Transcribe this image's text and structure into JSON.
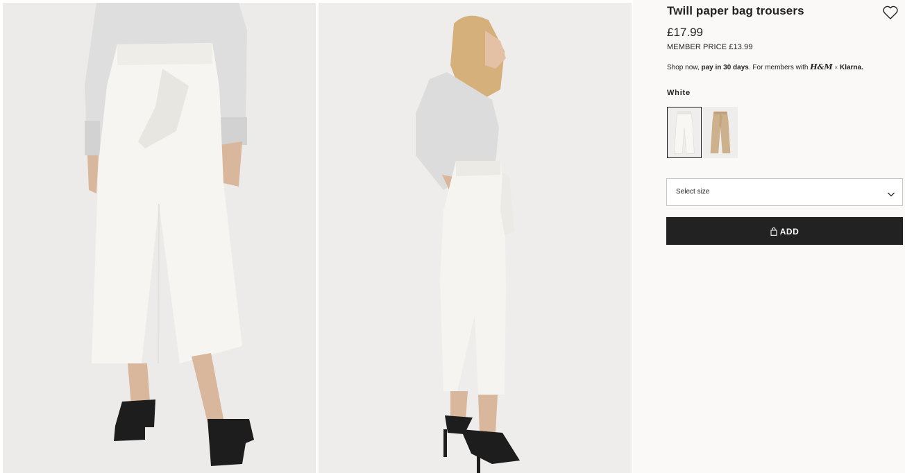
{
  "product": {
    "title": "Twill paper bag trousers",
    "price": "£17.99",
    "member_price": "MEMBER PRICE £13.99",
    "klarna": {
      "prefix": "Shop now, ",
      "bold": "pay in 30 days",
      "suffix": ". For members with ",
      "hm_logo": "H&M",
      "separator": "×",
      "klarna_brand": "Klarna."
    },
    "favorite_icon": "heart-icon"
  },
  "images": [
    {
      "alt": "trousers-front-view"
    },
    {
      "alt": "trousers-side-view"
    }
  ],
  "color": {
    "selected_label": "White",
    "swatches": [
      {
        "name": "white",
        "hex": "#f1efe8",
        "selected": true
      },
      {
        "name": "beige",
        "hex": "#cdb08c",
        "selected": false
      }
    ]
  },
  "size_select": {
    "placeholder": "Select size",
    "icon": "chevron-down-icon"
  },
  "add_button": {
    "label": "ADD",
    "icon": "shopping-bag-icon",
    "bg": "#222222"
  }
}
